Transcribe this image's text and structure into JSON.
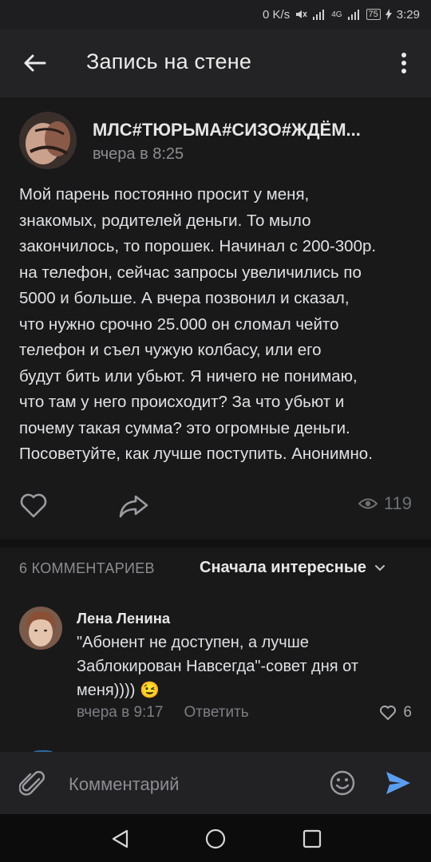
{
  "status_bar": {
    "speed": "0 K/s",
    "network": "4G",
    "battery": "75",
    "time": "3:29"
  },
  "app_bar": {
    "title": "Запись на стене",
    "back_icon": "arrow-left-icon",
    "more_icon": "more-vertical-icon"
  },
  "post": {
    "group_name": "МЛС#ТЮРЬМА#СИЗО#ЖДЁМ...",
    "time": "вчера в 8:25",
    "text": "Мой парень постоянно просит у меня,\nзнакомых, родителей деньги. То мыло\nзакончилось, то порошек. Начинал с 200-300р.\nна телефон, сейчас запросы увеличились по\n5000 и больше.  А вчера позвонил и сказал,\nчто нужно срочно 25.000 он сломал чейто\nтелефон и съел чужую колбасу, или его\nбудут бить или убьют. Я ничего не понимаю,\nчто там у него происходит? За что убьют и\nпочему такая сумма? это огромные деньги.\nПосоветуйте, как лучше поступить. Анонимно.",
    "views": "119",
    "icons": [
      "heart-icon",
      "share-icon",
      "eye-icon"
    ]
  },
  "comments": {
    "count_label": "6 КОММЕНТАРИЕВ",
    "sort_label": "Сначала интересные",
    "items": [
      {
        "author": "Лена Ленина",
        "text": "\"Абонент не доступен, а лучше\nЗаблокирован Навсегда\"-совет дня от\nменя))))",
        "emoji": "😉",
        "time": "вчера в 9:17",
        "reply_label": "Ответить",
        "likes": "6"
      }
    ]
  },
  "input_bar": {
    "placeholder": "Комментарий",
    "attach_icon": "paperclip-icon",
    "emoji_icon": "smiley-icon",
    "send_icon": "send-icon"
  },
  "colors": {
    "background": "#19191a",
    "app_bar": "#232325",
    "accent_send": "#5b9ef0",
    "secondary_text": "#8b8d91"
  }
}
